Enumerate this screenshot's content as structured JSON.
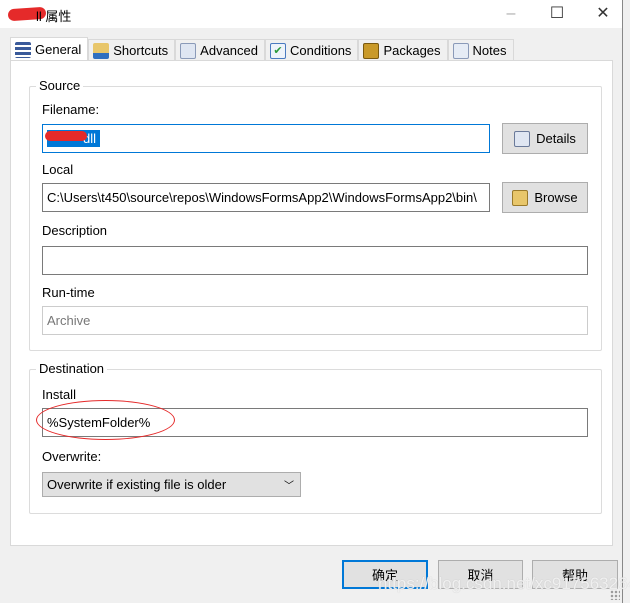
{
  "window": {
    "title": "ll 属性",
    "minimize": "–",
    "maximize": "☐",
    "close": "✕"
  },
  "tabs": [
    {
      "label": "General",
      "icon": "list-icon"
    },
    {
      "label": "Shortcuts",
      "icon": "folder-icon"
    },
    {
      "label": "Advanced",
      "icon": "document-icon"
    },
    {
      "label": "Conditions",
      "icon": "checklist-icon"
    },
    {
      "label": "Packages",
      "icon": "package-icon"
    },
    {
      "label": "Notes",
      "icon": "pencil-icon"
    }
  ],
  "source": {
    "title": "Source",
    "filename_label": "Filename:",
    "filename_value": "dll",
    "details_button": "Details",
    "local_label": "Local",
    "local_value": "C:\\Users\\t450\\source\\repos\\WindowsFormsApp2\\WindowsFormsApp2\\bin\\",
    "browse_button": "Browse",
    "description_label": "Description",
    "description_value": "",
    "runtime_label": "Run-time",
    "runtime_value": "Archive"
  },
  "destination": {
    "title": "Destination",
    "install_label": "Install",
    "install_value": "%SystemFolder%",
    "overwrite_label": "Overwrite:",
    "overwrite_value": "Overwrite if existing file is older"
  },
  "buttons": {
    "ok": "确定",
    "cancel": "取消",
    "help": "帮助"
  },
  "watermark": "https://blog.csdn.net/xc917563264",
  "colors": {
    "accent": "#0078d7",
    "annotation": "#e52a2a"
  }
}
